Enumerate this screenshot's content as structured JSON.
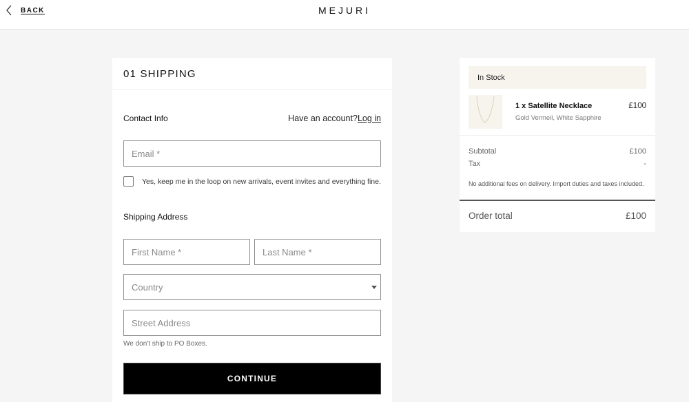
{
  "header": {
    "back_label": "BACK",
    "logo": "MEJURI"
  },
  "form": {
    "title": "01 SHIPPING",
    "contact_label": "Contact Info",
    "account_prompt": "Have an account?",
    "login_label": "Log in",
    "email_placeholder": "Email *",
    "email_value": "",
    "newsletter_label": "Yes, keep me in the loop on new arrivals, event invites and everything fine.",
    "newsletter_checked": false,
    "shipping_label": "Shipping Address",
    "first_name_placeholder": "First Name *",
    "last_name_placeholder": "Last Name *",
    "country_selected": "Country",
    "street_placeholder": "Street Address",
    "po_hint": "We don't ship to PO Boxes.",
    "continue_label": "CONTINUE"
  },
  "summary": {
    "stock_status": "In Stock",
    "items": [
      {
        "name": "1 x Satellite Necklace",
        "variant": "Gold Vermeil, White Sapphire",
        "price": "£100",
        "image_icon": "necklace-image"
      }
    ],
    "subtotal_label": "Subtotal",
    "subtotal_value": "£100",
    "tax_label": "Tax",
    "tax_value": "-",
    "note": "No additional fees on delivery. Import duties and taxes included.",
    "total_label": "Order total",
    "total_value": "£100"
  },
  "colors": {
    "page_background": "#f5f5f5",
    "banner_background": "#f7f4ee",
    "button_background": "#000000"
  }
}
